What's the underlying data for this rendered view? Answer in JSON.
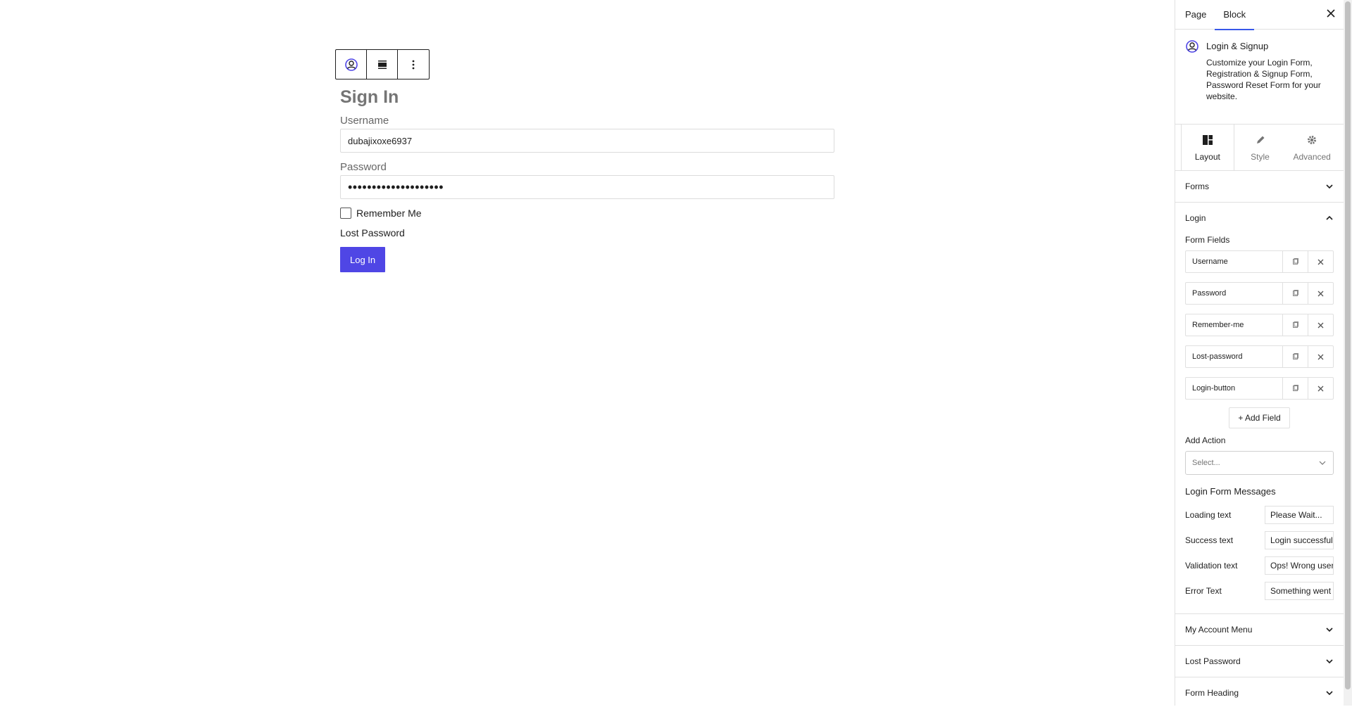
{
  "toolbar": {
    "block_icon": "user-circle-icon",
    "align_icon": "align-icon",
    "more_icon": "more-vertical-icon"
  },
  "form": {
    "title": "Sign In",
    "username_label": "Username",
    "username_value": "dubajixoxe6937",
    "password_label": "Password",
    "password_value": "••••••••••••••••••••",
    "remember_label": "Remember Me",
    "lost_password": "Lost Password",
    "login_button": "Log In",
    "accent": "#4f46e5"
  },
  "sidebar": {
    "tabs": [
      "Page",
      "Block"
    ],
    "active_tab": "Block",
    "block": {
      "name": "Login & Signup",
      "description": "Customize your Login Form, Registration & Signup Form, Password Reset Form for your website."
    },
    "panel_tabs": [
      "Layout",
      "Style",
      "Advanced"
    ],
    "active_panel_tab": "Layout",
    "sections": {
      "forms": "Forms",
      "login": "Login",
      "my_account_menu": "My Account Menu",
      "lost_password": "Lost Password",
      "form_heading": "Form Heading"
    },
    "login": {
      "form_fields_label": "Form Fields",
      "fields": [
        "Username",
        "Password",
        "Remember-me",
        "Lost-password",
        "Login-button"
      ],
      "add_field": "+ Add Field",
      "add_action_label": "Add Action",
      "add_action_placeholder": "Select...",
      "messages_title": "Login Form Messages",
      "messages": [
        {
          "label": "Loading text",
          "value": "Please Wait..."
        },
        {
          "label": "Success text",
          "value": "Login successful"
        },
        {
          "label": "Validation text",
          "value": "Ops! Wrong username"
        },
        {
          "label": "Error Text",
          "value": "Something went wrong"
        }
      ]
    }
  }
}
